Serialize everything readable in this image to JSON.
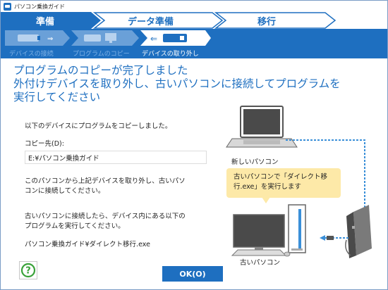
{
  "window": {
    "title": "パソコン乗換ガイド"
  },
  "steps": [
    {
      "label": "準備",
      "active": true
    },
    {
      "label": "データ準備",
      "active": false
    },
    {
      "label": "移行",
      "active": false
    }
  ],
  "substeps": [
    {
      "label": "デバイスの接続"
    },
    {
      "label": "プログラムのコピー"
    },
    {
      "label": "デバイスの取り外し"
    }
  ],
  "heading": {
    "line1": "プログラムのコピーが完了しました",
    "line2": "外付けデバイスを取り外し、古いパソコンに接続してプログラムを",
    "line3": "実行してください"
  },
  "body": {
    "copied_text": "以下のデバイスにプログラムをコピーしました。",
    "dest_label": "コピー先(D):",
    "dest_value": "E:¥パソコン乗換ガイド",
    "remove_line1": "このパソコンから上記デバイスを取り外し、古いパソ",
    "remove_line2": "コンに接続してください。",
    "run_line1": "古いパソコンに接続したら、デバイス内にある以下の",
    "run_line2": "プログラムを実行してください。",
    "program_path": "パソコン乗換ガイド¥ダイレクト移行.exe"
  },
  "illustration": {
    "new_pc_label": "新しいパソコン",
    "old_pc_label": "古いパソコン",
    "callout_line1": "古いパソコンで「ダイレクト移",
    "callout_line2": "行.exe」を実行します"
  },
  "footer": {
    "help_symbol": "?",
    "ok_label": "OK(O)"
  },
  "colors": {
    "accent": "#1e6fc0",
    "callout": "#fde9a8",
    "help_green": "#3aa23a"
  }
}
